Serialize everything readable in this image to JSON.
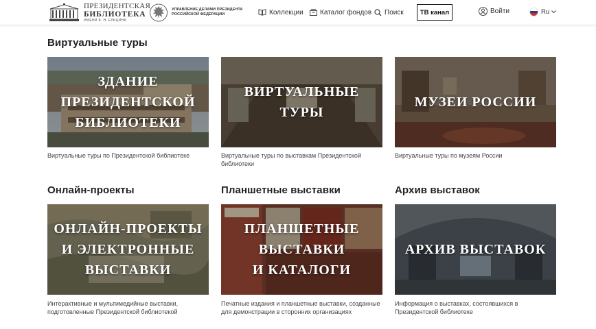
{
  "header": {
    "logo": {
      "line1": "ПРЕЗИДЕНТСКАЯ",
      "line2": "БИБЛИОТЕКА",
      "line3": "ИМЕНИ Б. Н. ЕЛЬЦИНА"
    },
    "admin": "Управление делами Президента Российской Федерации",
    "nav": {
      "collections": "Коллекции",
      "catalog": "Каталог фондов",
      "search": "Поиск"
    },
    "tv_button": "ТВ канал",
    "login": "Войти",
    "lang": "Ru"
  },
  "sections": [
    {
      "title": "Виртуальные туры",
      "cards": [
        {
          "overlay": "ЗДАНИЕ\nПРЕЗИДЕНТСКОЙ\nБИБЛИОТЕКИ",
          "caption": "Виртуальные туры по Президентской библиотеке"
        },
        {
          "overlay": "ВИРТУАЛЬНЫЕ\nТУРЫ",
          "caption": "Виртуальные туры по выставкам Президентской библиотеки"
        },
        {
          "overlay": "МУЗЕИ РОССИИ",
          "caption": "Виртуальные туры по музеям России"
        }
      ]
    },
    {
      "titles": [
        "Онлайн-проекты",
        "Планшетные выставки",
        "Архив выставок"
      ],
      "cards": [
        {
          "overlay": "ОНЛАЙН-ПРОЕКТЫ\nИ ЭЛЕКТРОННЫЕ\nВЫСТАВКИ",
          "caption": "Интерактивные и мультимедийные выставки, подготовленные Президентской библиотекой"
        },
        {
          "overlay": "ПЛАНШЕТНЫЕ\nВЫСТАВКИ\nИ КАТАЛОГИ",
          "caption": "Печатные издания и планшетные выставки, созданные для демонстрации в сторонних организациях"
        },
        {
          "overlay": "АРХИВ ВЫСТАВОК",
          "caption": "Информация о выставках, состоявшихся в Президентской библиотеке"
        }
      ]
    }
  ],
  "colors": {
    "text": "#222222",
    "caption": "#444444",
    "border": "#111111"
  }
}
